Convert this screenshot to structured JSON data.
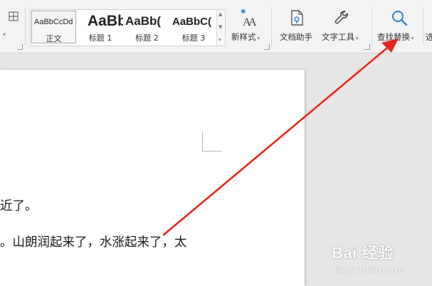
{
  "ribbon": {
    "styles": [
      {
        "sample": "AaBbCcDd",
        "name": "正文",
        "selected": true
      },
      {
        "sample": "AaBb",
        "name": "标题 1",
        "selected": false
      },
      {
        "sample": "AaBb(",
        "name": "标题 2",
        "selected": false
      },
      {
        "sample": "AaBbC(",
        "name": "标题 3",
        "selected": false
      }
    ],
    "new_style_label": "新样式",
    "doc_assistant_label": "文档助手",
    "text_tools_label": "文字工具",
    "find_replace_label": "查找替换",
    "cut_off_label": "选"
  },
  "document": {
    "line1": "近了。",
    "line2": "。山朗润起来了，水涨起来了，太"
  },
  "annotation": {
    "arrow_color": "#e8261f"
  },
  "watermark": {
    "logo": "Bai 经验",
    "url": "jingyan.baidu.com"
  },
  "colors": {
    "ribbon_bg": "#f3f3f3",
    "workspace_bg": "#e6e6e6",
    "accent_icon": "#2f7fd8"
  }
}
